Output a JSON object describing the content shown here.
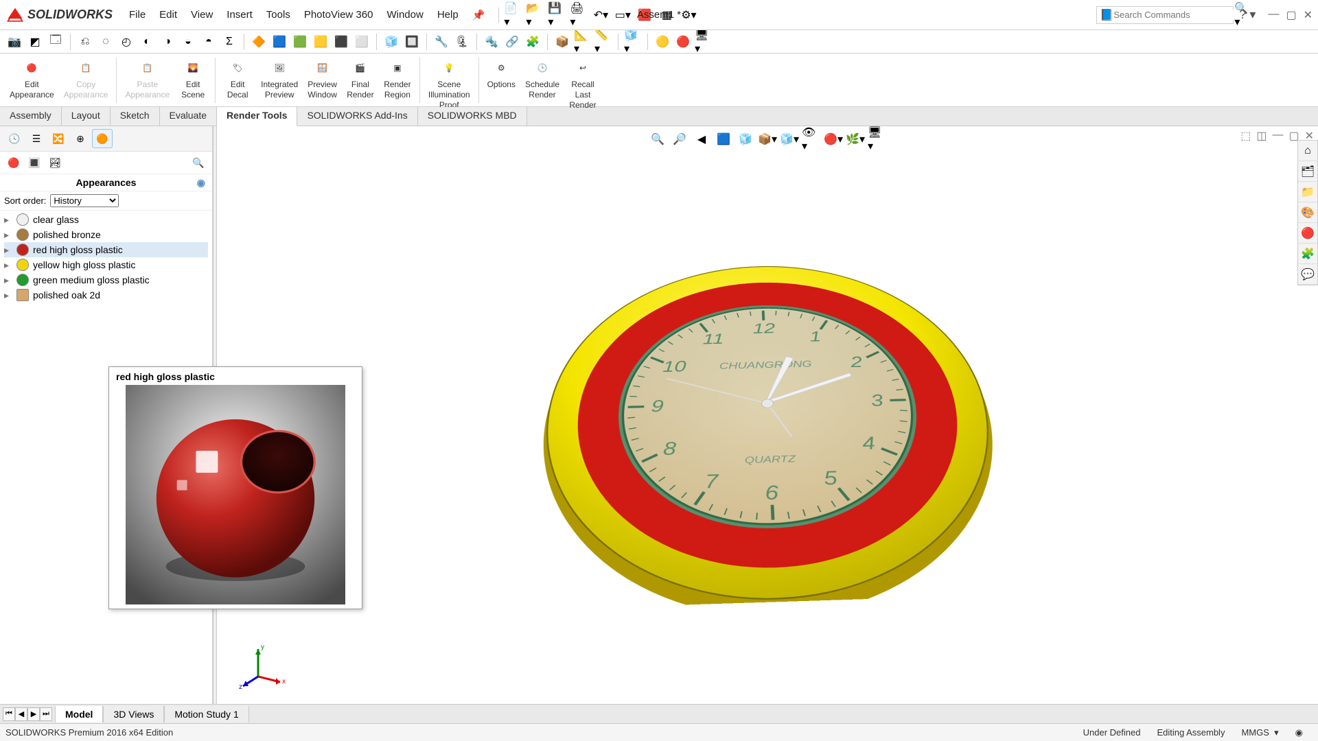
{
  "app": {
    "name": "SOLIDWORKS",
    "document": "Assem1 *",
    "search_placeholder": "Search Commands"
  },
  "menu": [
    "File",
    "Edit",
    "View",
    "Insert",
    "Tools",
    "PhotoView 360",
    "Window",
    "Help"
  ],
  "ribbon": [
    {
      "label": "Edit Appearance",
      "name": "edit-appearance",
      "disabled": false
    },
    {
      "label": "Copy Appearance",
      "name": "copy-appearance",
      "disabled": true
    },
    {
      "label": "Paste Appearance",
      "name": "paste-appearance",
      "disabled": true
    },
    {
      "label": "Edit Scene",
      "name": "edit-scene",
      "disabled": false
    },
    {
      "label": "Edit Decal",
      "name": "edit-decal",
      "disabled": false
    },
    {
      "label": "Integrated Preview",
      "name": "integrated-preview",
      "disabled": false
    },
    {
      "label": "Preview Window",
      "name": "preview-window",
      "disabled": false
    },
    {
      "label": "Final Render",
      "name": "final-render",
      "disabled": false
    },
    {
      "label": "Render Region",
      "name": "render-region",
      "disabled": false
    },
    {
      "label": "Scene Illumination Proof Sheet",
      "name": "scene-illum-proof-sheet",
      "disabled": false
    },
    {
      "label": "Options",
      "name": "options",
      "disabled": false
    },
    {
      "label": "Schedule Render",
      "name": "schedule-render",
      "disabled": false
    },
    {
      "label": "Recall Last Render",
      "name": "recall-last-render",
      "disabled": false
    }
  ],
  "tabs": [
    "Assembly",
    "Layout",
    "Sketch",
    "Evaluate",
    "Render Tools",
    "SOLIDWORKS Add-Ins",
    "SOLIDWORKS MBD"
  ],
  "active_tab": "Render Tools",
  "panel": {
    "title": "Appearances",
    "sort_label": "Sort order:",
    "sort_value": "History",
    "items": [
      {
        "label": "clear glass",
        "color": "#f0f0f0"
      },
      {
        "label": "polished bronze",
        "color": "#a87a3f"
      },
      {
        "label": "red high gloss plastic",
        "color": "#c0231e",
        "selected": true
      },
      {
        "label": "yellow high gloss plastic",
        "color": "#f2d40e"
      },
      {
        "label": "green medium gloss plastic",
        "color": "#1f9c2b"
      },
      {
        "label": "polished oak 2d",
        "color": "#d6a66a",
        "square": true
      }
    ]
  },
  "tooltip": {
    "title": "red high gloss plastic"
  },
  "bottom_tabs": [
    "Model",
    "3D Views",
    "Motion Study 1"
  ],
  "active_bottom_tab": "Model",
  "status": {
    "edition": "SOLIDWORKS Premium 2016 x64 Edition",
    "state": "Under Defined",
    "mode": "Editing Assembly",
    "units": "MMGS"
  },
  "clock": {
    "brand": "CHUANGRONG",
    "sub": "QUARTZ",
    "numbers": [
      "12",
      "1",
      "2",
      "3",
      "4",
      "5",
      "6",
      "7",
      "8",
      "9",
      "10",
      "11"
    ]
  }
}
